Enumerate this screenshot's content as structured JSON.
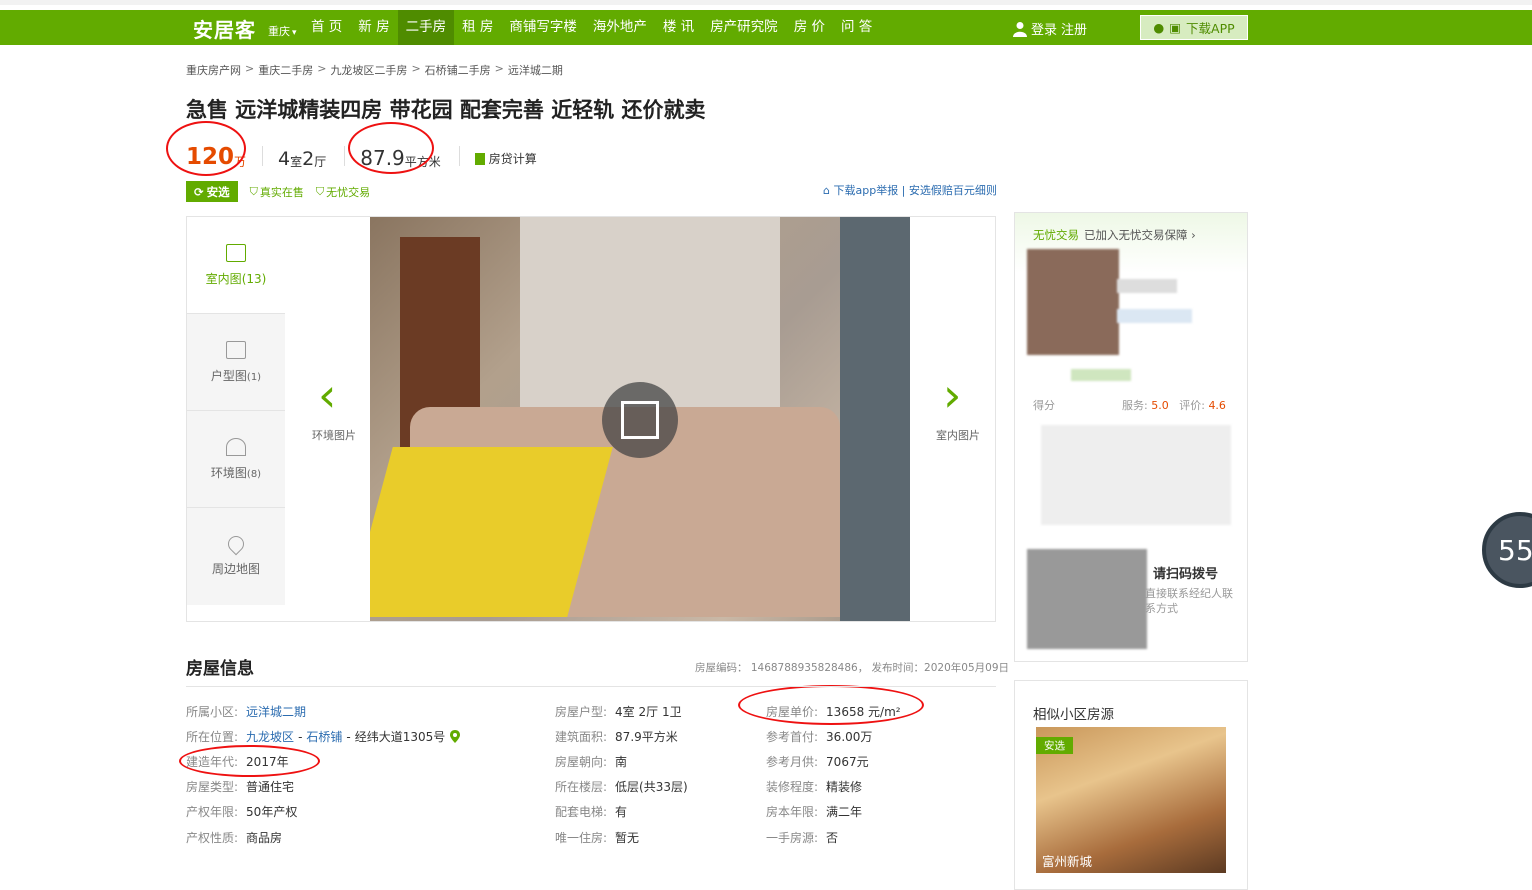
{
  "nav": {
    "logo": "安居客",
    "city": "重庆",
    "items": [
      "首 页",
      "新 房",
      "二手房",
      "租 房",
      "商铺写字楼",
      "海外地产",
      "楼 讯",
      "房产研究院",
      "房 价",
      "问 答"
    ],
    "active_index": 2,
    "login": "登录",
    "register": "注册",
    "download": "下载APP"
  },
  "breadcrumb": [
    "重庆房产网",
    "重庆二手房",
    "九龙坡区二手房",
    "石桥铺二手房",
    "远洋城二期"
  ],
  "listing": {
    "title": "急售 远洋城精装四房 带花园 配套完善 近轻轨 还价就卖",
    "price": "120",
    "price_unit": "万",
    "rooms": "4",
    "rooms_unit": "室",
    "halls": "2",
    "halls_unit": "厅",
    "area": "87.9",
    "area_unit": "平方米",
    "calc": "房贷计算",
    "tag_main": "安选",
    "tag_real": "真实在售",
    "tag_safe": "无忧交易",
    "report": "下载app举报 | 安选假赔百元细则"
  },
  "gallery": {
    "thumbs": [
      {
        "label": "室内图",
        "count": "(13)"
      },
      {
        "label": "户型图",
        "count": "(1)"
      },
      {
        "label": "环境图",
        "count": "(8)"
      },
      {
        "label": "周边地图",
        "count": ""
      }
    ],
    "prev_label": "环境图片",
    "next_label": "室内图片"
  },
  "agent": {
    "guarantee": "无忧交易",
    "guarantee_note": "已加入无忧交易保障 ›",
    "rating_prefix": "得分",
    "service_label": "服务:",
    "service": "5.0",
    "review_label": "评价:",
    "review": "4.6",
    "scan_title": "请扫码拨号",
    "scan_sub": "直接联系经纪人联系方式"
  },
  "house_info": {
    "title": "房屋信息",
    "meta": "房屋编码：  1468788935828486，  发布时间：2020年05月09日",
    "col1": [
      {
        "k": "所属小区:",
        "v": "远洋城二期"
      },
      {
        "k": "所在位置:",
        "v1": "九龙坡区",
        "v2": "石桥铺",
        "v3": "经纬大道1305号"
      },
      {
        "k": "建造年代:",
        "v": "2017年"
      },
      {
        "k": "房屋类型:",
        "v": "普通住宅"
      },
      {
        "k": "产权年限:",
        "v": "50年产权"
      },
      {
        "k": "产权性质:",
        "v": "商品房"
      }
    ],
    "col2": [
      {
        "k": "房屋户型:",
        "v": "4室 2厅 1卫"
      },
      {
        "k": "建筑面积:",
        "v": "87.9平方米"
      },
      {
        "k": "房屋朝向:",
        "v": "南"
      },
      {
        "k": "所在楼层:",
        "v": "低层(共33层)"
      },
      {
        "k": "配套电梯:",
        "v": "有"
      },
      {
        "k": "唯一住房:",
        "v": "暂无"
      }
    ],
    "col3": [
      {
        "k": "房屋单价:",
        "v": "13658 元/m²"
      },
      {
        "k": "参考首付:",
        "v": "36.00万"
      },
      {
        "k": "参考月供:",
        "v": "7067元"
      },
      {
        "k": "装修程度:",
        "v": "精装修"
      },
      {
        "k": "房本年限:",
        "v": "满二年"
      },
      {
        "k": "一手房源:",
        "v": "否"
      }
    ]
  },
  "similar": {
    "title": "相似小区房源",
    "tag": "安选",
    "name": "富州新城"
  },
  "widget": {
    "value": "55"
  },
  "colors": {
    "brand": "#62ab00",
    "price": "#e54b00",
    "annotation": "#e11111"
  }
}
